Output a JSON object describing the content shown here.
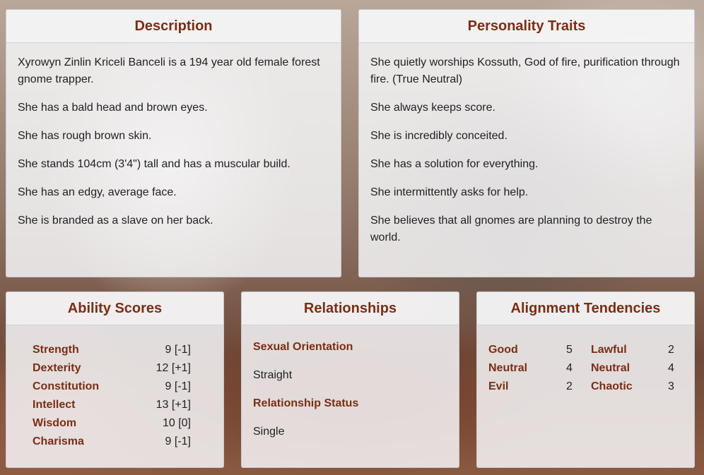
{
  "description": {
    "title": "Description",
    "lines": [
      "Xyrowyn Zinlin Kriceli Banceli is a 194 year old female forest gnome trapper.",
      "She has a bald head and brown eyes.",
      "She has rough brown skin.",
      "She stands 104cm (3'4\") tall and has a muscular build.",
      "She has an edgy, average face.",
      "She is branded as a slave on her back."
    ]
  },
  "personality": {
    "title": "Personality Traits",
    "lines": [
      "She quietly worships Kossuth, God of fire, purification through fire. (True Neutral)",
      "She always keeps score.",
      "She is incredibly conceited.",
      "She has a solution for everything.",
      "She intermittently asks for help.",
      "She believes that all gnomes are planning to destroy the world."
    ]
  },
  "abilities": {
    "title": "Ability Scores",
    "rows": [
      {
        "name": "Strength",
        "value": "9 [-1]"
      },
      {
        "name": "Dexterity",
        "value": "12 [+1]"
      },
      {
        "name": "Constitution",
        "value": "9 [-1]"
      },
      {
        "name": "Intellect",
        "value": "13 [+1]"
      },
      {
        "name": "Wisdom",
        "value": "10 [0]"
      },
      {
        "name": "Charisma",
        "value": "9 [-1]"
      }
    ]
  },
  "relationships": {
    "title": "Relationships",
    "orientation_label": "Sexual Orientation",
    "orientation_value": "Straight",
    "status_label": "Relationship Status",
    "status_value": "Single"
  },
  "alignment": {
    "title": "Alignment Tendencies",
    "rows": [
      {
        "l1": "Good",
        "v1": "5",
        "l2": "Lawful",
        "v2": "2"
      },
      {
        "l1": "Neutral",
        "v1": "4",
        "l2": "Neutral",
        "v2": "4"
      },
      {
        "l1": "Evil",
        "v1": "2",
        "l2": "Chaotic",
        "v2": "3"
      }
    ]
  }
}
